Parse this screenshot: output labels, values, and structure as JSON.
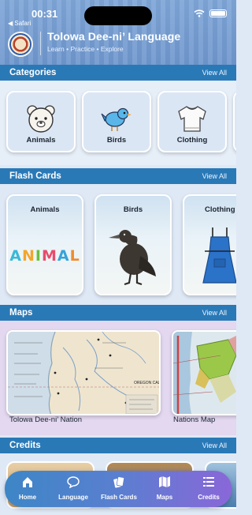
{
  "status_bar": {
    "time": "00:31",
    "back_label": "◀ Safari"
  },
  "header": {
    "title": "Tolowa Dee-ni’ Language",
    "subtitle": "Learn • Practice • Explore"
  },
  "sections": {
    "categories": {
      "title": "Categories",
      "link": "View All"
    },
    "flash_cards": {
      "title": "Flash Cards",
      "link": "View All"
    },
    "maps": {
      "title": "Maps",
      "link": "View All"
    },
    "credits": {
      "title": "Credits",
      "link": "View All"
    }
  },
  "categories": [
    {
      "label": "Animals",
      "icon": "bear-icon"
    },
    {
      "label": "Birds",
      "icon": "bird-icon"
    },
    {
      "label": "Clothing",
      "icon": "sweater-icon"
    }
  ],
  "flash_cards": [
    {
      "label": "Animals",
      "art": "animal-word-art",
      "word": "ANIMAL"
    },
    {
      "label": "Birds",
      "art": "bird-art"
    },
    {
      "label": "Clothing",
      "art": "apron-art"
    }
  ],
  "maps": [
    {
      "label": "Tolowa Dee-ni’ Nation",
      "map_text": "OREGON CALIFORNIA"
    },
    {
      "label": "Nations Map"
    }
  ],
  "tabs": [
    {
      "label": "Home",
      "icon": "home-icon",
      "active": true
    },
    {
      "label": "Language",
      "icon": "chat-bubble-icon",
      "active": false
    },
    {
      "label": "Flash Cards",
      "icon": "cards-icon",
      "active": false
    },
    {
      "label": "Maps",
      "icon": "map-icon",
      "active": false
    },
    {
      "label": "Credits",
      "icon": "list-icon",
      "active": false
    }
  ],
  "colors": {
    "section_bar": "#2a79b7",
    "header": "#7fa6d8",
    "tab_gradient_start": "#3d86c6",
    "tab_gradient_end": "#8a67d8"
  }
}
